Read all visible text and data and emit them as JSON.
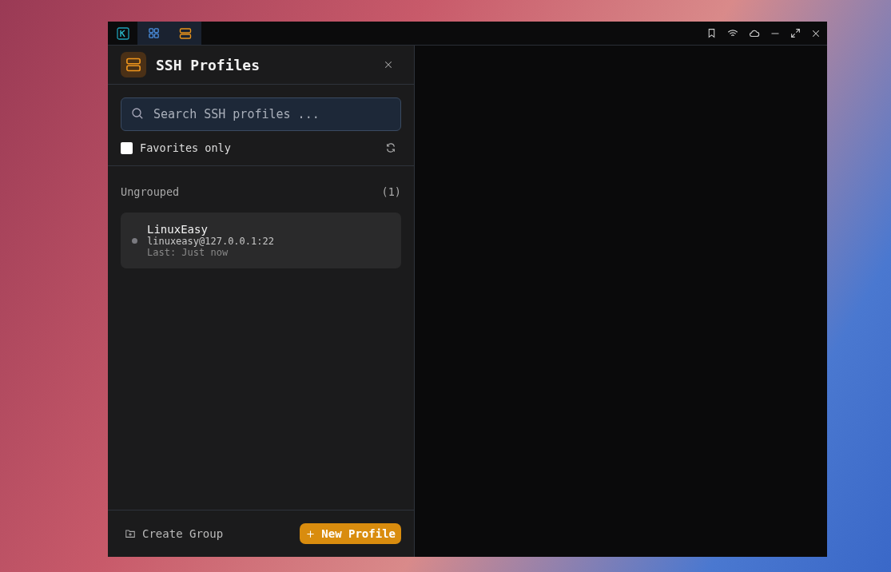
{
  "titlebar": {
    "tabs": [
      {
        "kind": "grid",
        "selected": true
      },
      {
        "kind": "server",
        "selected": true
      }
    ]
  },
  "panel": {
    "title": "SSH Profiles",
    "search": {
      "placeholder": "Search SSH profiles ..."
    },
    "favorites_only": {
      "label": "Favorites only",
      "checked": false
    },
    "groups": [
      {
        "name": "Ungrouped",
        "count": "(1)",
        "profiles": [
          {
            "name": "LinuxEasy",
            "address": "linuxeasy@127.0.0.1:22",
            "last": "Last: Just now",
            "online": false
          }
        ]
      }
    ],
    "footer": {
      "create_group": "Create Group",
      "new_profile": "New Profile"
    }
  }
}
